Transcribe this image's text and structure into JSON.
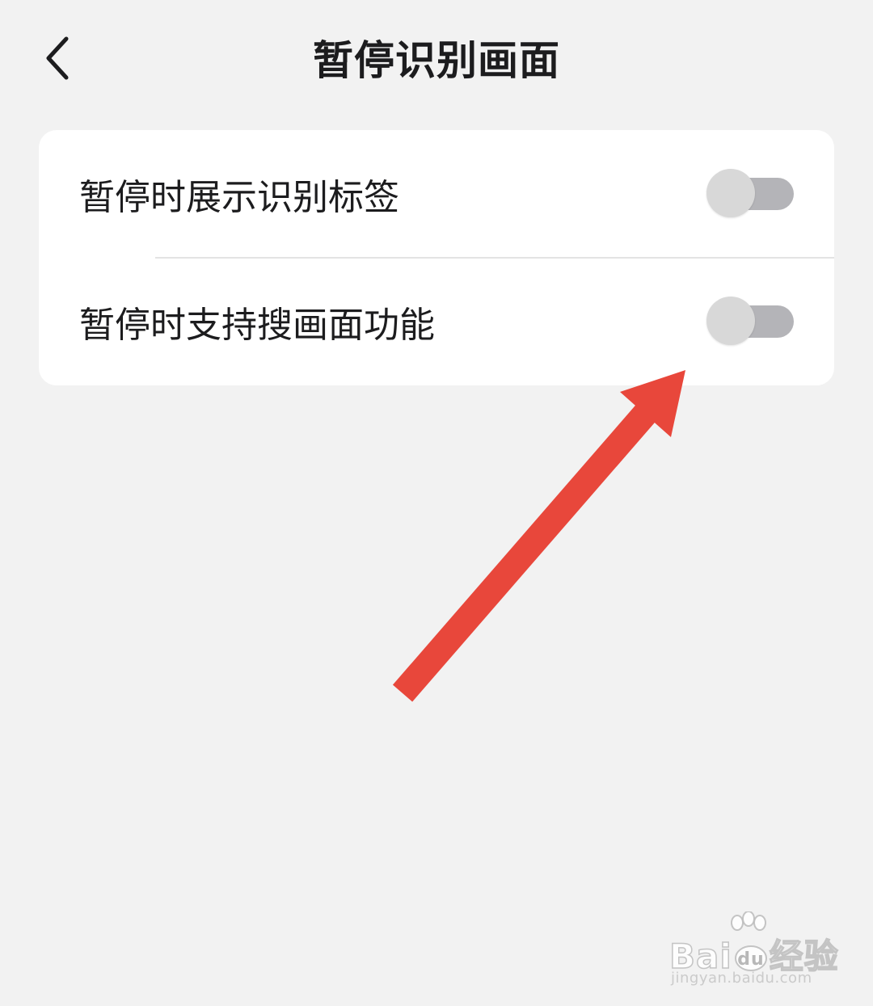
{
  "header": {
    "back_icon": "chevron-left-icon",
    "title": "暂停识别画面"
  },
  "settings": [
    {
      "label": "暂停时展示识别标签",
      "enabled": false
    },
    {
      "label": "暂停时支持搜画面功能",
      "enabled": false
    }
  ],
  "annotation": {
    "color": "#e8473b"
  },
  "watermark": {
    "brand_prefix": "Bai",
    "brand_suffix": "经验",
    "url": "jingyan.baidu.com"
  },
  "colors": {
    "background": "#f2f2f2",
    "card": "#ffffff",
    "toggle_track": "#b4b4b8",
    "toggle_knob": "#d8d8d8"
  }
}
